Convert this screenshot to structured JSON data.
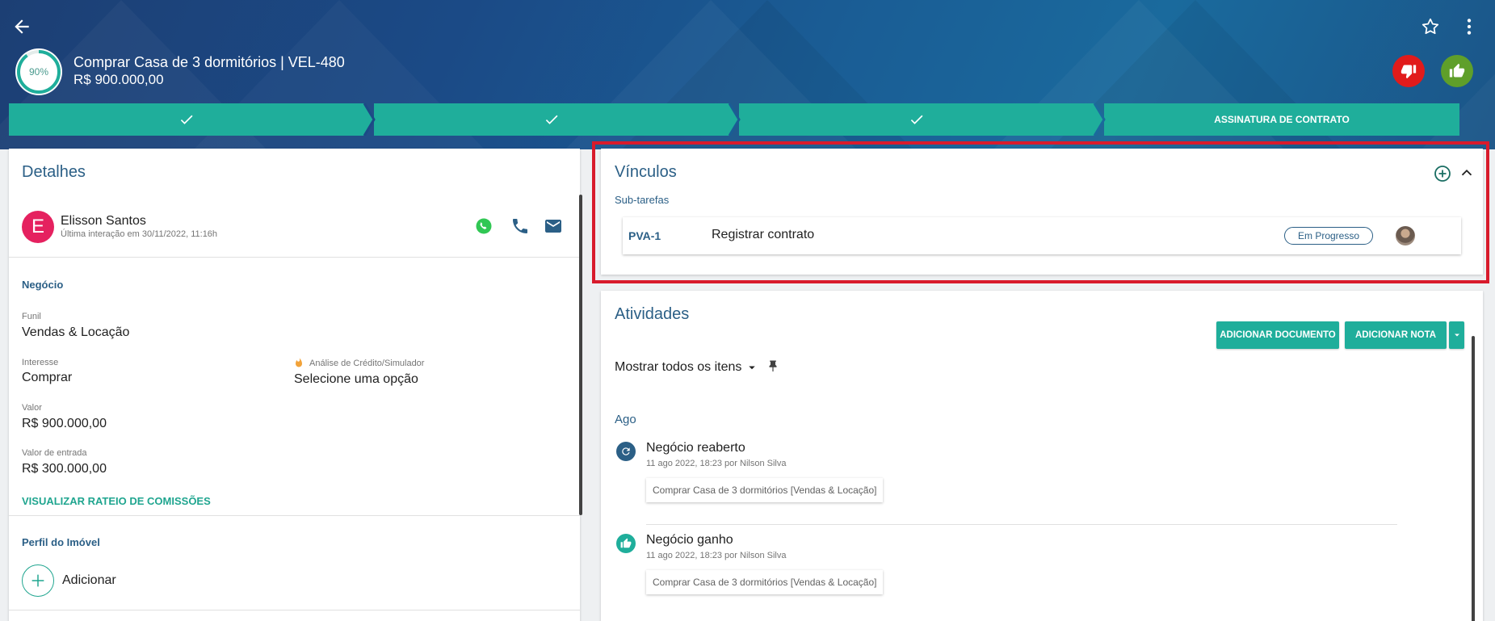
{
  "header": {
    "progress_percent": 90,
    "progress_label": "90%",
    "deal_title": "Comprar Casa de 3 dormitórios | VEL-480",
    "deal_value": "R$ 900.000,00",
    "back_icon": "arrow-left-icon",
    "favorite_icon": "star-outline-icon",
    "more_icon": "more-vertical-icon",
    "lose_color": "#e11b1b",
    "win_color": "#5f9f2a"
  },
  "stages": [
    {
      "label": "",
      "done": true
    },
    {
      "label": "",
      "done": true
    },
    {
      "label": "",
      "done": true
    },
    {
      "label": "ASSINATURA DE CONTRATO",
      "done": false
    }
  ],
  "details": {
    "title": "Detalhes",
    "contact": {
      "initial": "E",
      "name": "Elisson Santos",
      "last_interaction": "Última interação em 30/11/2022, 11:16h"
    },
    "business_section": "Negócio",
    "fields": {
      "funil_label": "Funil",
      "funil_value": "Vendas & Locação",
      "interesse_label": "Interesse",
      "interesse_value": "Comprar",
      "analise_label": "Análise de Crédito/Simulador",
      "analise_value": "Selecione uma opção",
      "valor_label": "Valor",
      "valor_value": "R$ 900.000,00",
      "entrada_label": "Valor de entrada",
      "entrada_value": "R$ 300.000,00"
    },
    "commission_link": "VISUALIZAR RATEIO DE COMISSÕES",
    "property_section": "Perfil do Imóvel",
    "add_label": "Adicionar"
  },
  "links": {
    "title": "Vínculos",
    "subtasks_label": "Sub-tarefas",
    "subtasks": [
      {
        "key": "PVA-1",
        "name": "Registrar contrato",
        "status": "Em Progresso"
      }
    ]
  },
  "activities": {
    "title": "Atividades",
    "add_document": "ADICIONAR DOCUMENTO",
    "add_note": "ADICIONAR NOTA",
    "filter": "Mostrar todos os itens",
    "group": "Ago",
    "items": [
      {
        "title": "Negócio reaberto",
        "meta": "11 ago 2022, 18:23 por Nilson Silva",
        "chip": "Comprar Casa de 3 dormitórios [Vendas & Locação]",
        "icon": "refresh-icon",
        "color": "#2b5f86"
      },
      {
        "title": "Negócio ganho",
        "meta": "11 ago 2022, 18:23 por Nilson Silva",
        "chip": "Comprar Casa de 3 dormitórios [Vendas & Locação]",
        "icon": "thumb-up-icon",
        "color": "#1fae9b"
      }
    ]
  },
  "colors": {
    "accent_teal": "#1fae9b",
    "title_blue": "#2b5f86",
    "highlight_red": "#d81b2c"
  }
}
